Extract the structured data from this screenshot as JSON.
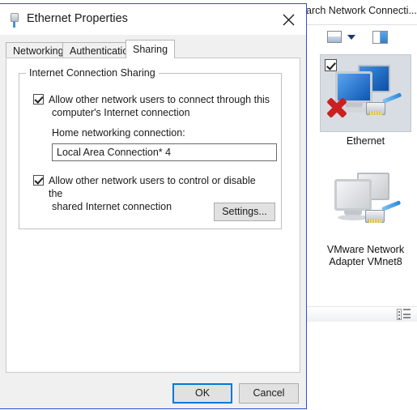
{
  "explorer": {
    "search": {
      "value": "arch Network Connecti...",
      "placeholder": "Search Network Connections"
    },
    "toolbar": {
      "view_icon": "view-layout-icon",
      "dropdown_icon": "chevron-down-icon",
      "preview_pane_icon": "preview-pane-icon"
    },
    "items": [
      {
        "label": "Ethernet",
        "state": "disabled",
        "selected": true,
        "icon": "network-connection-icon"
      },
      {
        "label": "VMware Network Adapter VMnet8",
        "state": "enabled",
        "selected": false,
        "icon": "network-adapter-icon"
      }
    ],
    "statusbar": {
      "details_pane_icon": "details-pane-icon"
    }
  },
  "dialog": {
    "title": "Ethernet Properties",
    "title_icon": "network-plug-icon",
    "close_icon": "close-icon",
    "tabs": [
      {
        "label": "Networking",
        "active": false
      },
      {
        "label": "Authentication",
        "active": false
      },
      {
        "label": "Sharing",
        "active": true
      }
    ],
    "sharing": {
      "groupbox_label": "Internet Connection Sharing",
      "allow_connect": {
        "checked": true,
        "line1": "Allow other network users to connect through this",
        "line2": "computer's Internet connection"
      },
      "home_networking_label": "Home networking connection:",
      "home_networking_value": "Local Area Connection* 4",
      "allow_control": {
        "checked": true,
        "line1": "Allow other network users to control or disable the",
        "line2": "shared Internet connection"
      },
      "settings_button": "Settings..."
    },
    "buttons": {
      "ok": "OK",
      "cancel": "Cancel"
    },
    "accent_color": "#0078d7",
    "border_color": "#2a4fd6"
  }
}
